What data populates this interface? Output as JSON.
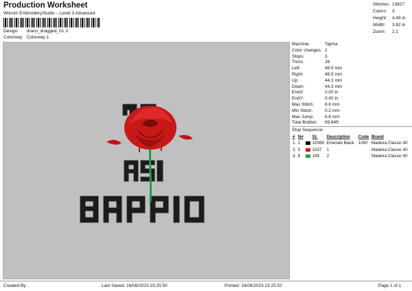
{
  "header": {
    "title": "Production Worksheet",
    "subtitle": "Wilcom EmbroideryStudio – Level 3 Advanced",
    "design_label": "Design:",
    "design_value": "draco_dragged_01 3",
    "colorway_label": "Colorway:",
    "colorway_value": "Colorway 1"
  },
  "stats": [
    {
      "label": "Stitches:",
      "value": "13627"
    },
    {
      "label": "Colors:",
      "value": "3"
    },
    {
      "label": "Height:",
      "value": "3.49 in"
    },
    {
      "label": "Width:",
      "value": "3.82 in"
    },
    {
      "label": "Zoom:",
      "value": "1:1"
    }
  ],
  "info": [
    {
      "label": "Machine:",
      "value": "Tajima"
    },
    {
      "label": "Color changes:",
      "value": "2"
    },
    {
      "label": "Stops:",
      "value": "3"
    },
    {
      "label": "Trims:",
      "value": "26"
    },
    {
      "label": "Left:",
      "value": "48.5 mm"
    },
    {
      "label": "Right:",
      "value": "48.5 mm"
    },
    {
      "label": "Up:",
      "value": "44.3 mm"
    },
    {
      "label": "Down:",
      "value": "44.3 mm"
    },
    {
      "label": "EndX:",
      "value": "0.00 in"
    },
    {
      "label": "EndY:",
      "value": "0.00 in"
    },
    {
      "label": "Max Stitch:",
      "value": "8.6 mm"
    },
    {
      "label": "Min Stitch:",
      "value": "0.2 mm"
    },
    {
      "label": "Max Jump:",
      "value": "6.8 mm"
    },
    {
      "label": "Total Bobbin:",
      "value": "69.64ft"
    }
  ],
  "sequence": {
    "title": "Stop Sequence:",
    "headers": [
      "#",
      "N#",
      "",
      "St.",
      "Description",
      "Code",
      "Brand"
    ],
    "rows": [
      {
        "num": "1.",
        "n": "1",
        "color": "#000000",
        "st": "10089",
        "desc": "Emerald Black",
        "code": "1000",
        "brand": "Madeira Classic 40"
      },
      {
        "num": "2.",
        "n": "5",
        "color": "#e01010",
        "st": "3337",
        "desc": "1",
        "code": "",
        "brand": "Madeira Classic 40"
      },
      {
        "num": "3.",
        "n": "6",
        "color": "#1aa64a",
        "st": "199",
        "desc": "2",
        "code": "",
        "brand": "Madeira Classic 40"
      }
    ]
  },
  "design": {
    "lines": [
      "JO",
      "ASI",
      "BARRIO"
    ]
  },
  "footer": {
    "created": "Created By:",
    "last_saved": "Last Saved: 16/06/2023 23.25.50",
    "printed": "Printed: 16/06/2023 23.25.52",
    "page": "Page 1 of 1"
  }
}
